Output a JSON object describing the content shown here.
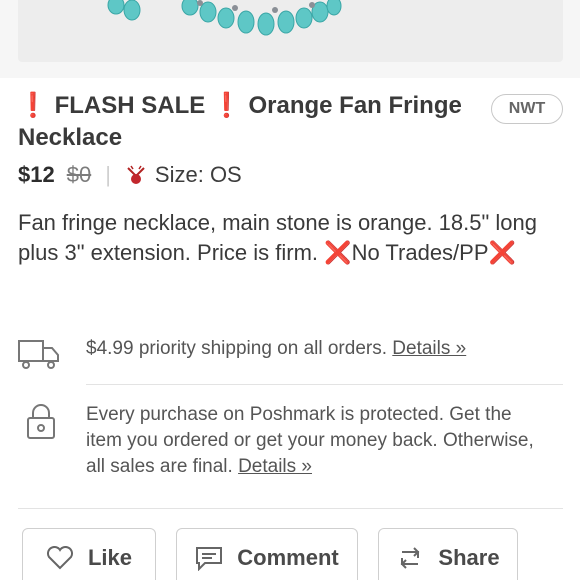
{
  "listing": {
    "title_prefix_mark": "❗",
    "title_flash": "FLASH SALE",
    "title_mid_mark": "❗",
    "title_rest": "Orange Fan Fringe Necklace",
    "badge": "NWT",
    "price": "$12",
    "original_price": "$0",
    "separator": "|",
    "size": "Size: OS",
    "description_part1": "Fan fringe necklace, main stone is orange. 18.5\" long plus 3\" extension. Price is firm. ",
    "description_x1": "❌",
    "description_part2": "No Trades/PP",
    "description_x2": "❌"
  },
  "shipping": {
    "text": "$4.99 priority shipping on all orders. ",
    "details_link": "Details »"
  },
  "protection": {
    "text": "Every purchase on Poshmark is protected. Get the item you ordered or get your money back. Otherwise, all sales are final. ",
    "details_link": "Details »"
  },
  "actions": {
    "like": "Like",
    "comment": "Comment",
    "share": "Share"
  },
  "colors": {
    "accent_red": "#e0252b",
    "bead": "#5fc9c9"
  }
}
